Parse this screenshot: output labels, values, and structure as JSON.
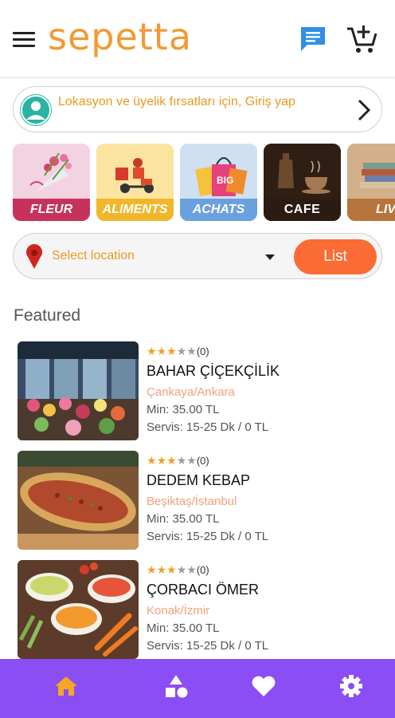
{
  "header": {
    "logo_text": "sepetta",
    "icons": [
      "menu-icon",
      "chat-icon",
      "cart-add-icon"
    ]
  },
  "login_banner": {
    "text": "Lokasyon ve üyelik fırsatları için, Giriş yap",
    "icon": "user-avatar-icon",
    "arrow": "chevron-right-icon"
  },
  "categories": [
    {
      "label": "FLEUR",
      "color": "#c7325c"
    },
    {
      "label": "ALIMENTS",
      "color": "#f1b72a"
    },
    {
      "label": "ACHATS",
      "color": "#6aa0de"
    },
    {
      "label": "CAFE",
      "color": "#3a2418"
    },
    {
      "label": "LIV",
      "color": "#b7743d"
    }
  ],
  "location": {
    "placeholder": "Select location",
    "button_label": "List",
    "accent": "#fb6b34"
  },
  "featured": {
    "title": "Featured",
    "stores": [
      {
        "rating_count": "(0)",
        "stars": 3,
        "name": "BAHAR ÇİÇEKÇİLİK",
        "location": "Çankaya/Ankara",
        "min": "Min: 35.00 TL",
        "service": "Servis: 15-25 Dk / 0 TL"
      },
      {
        "rating_count": "(0)",
        "stars": 3,
        "name": "DEDEM KEBAP",
        "location": "Beşiktaş/İstanbul",
        "min": "Min: 35.00 TL",
        "service": "Servis: 15-25 Dk / 0 TL"
      },
      {
        "rating_count": "(0)",
        "stars": 3,
        "name": "ÇORBACI ÖMER",
        "location": "Konak/İzmir",
        "min": "Min: 35.00 TL",
        "service": "Servis: 15-25 Dk / 0 TL"
      }
    ]
  },
  "bottom_nav": {
    "background": "#8b4df4",
    "items": [
      "home-icon",
      "shapes-icon",
      "heart-icon",
      "settings-icon"
    ],
    "active": "home-icon"
  }
}
